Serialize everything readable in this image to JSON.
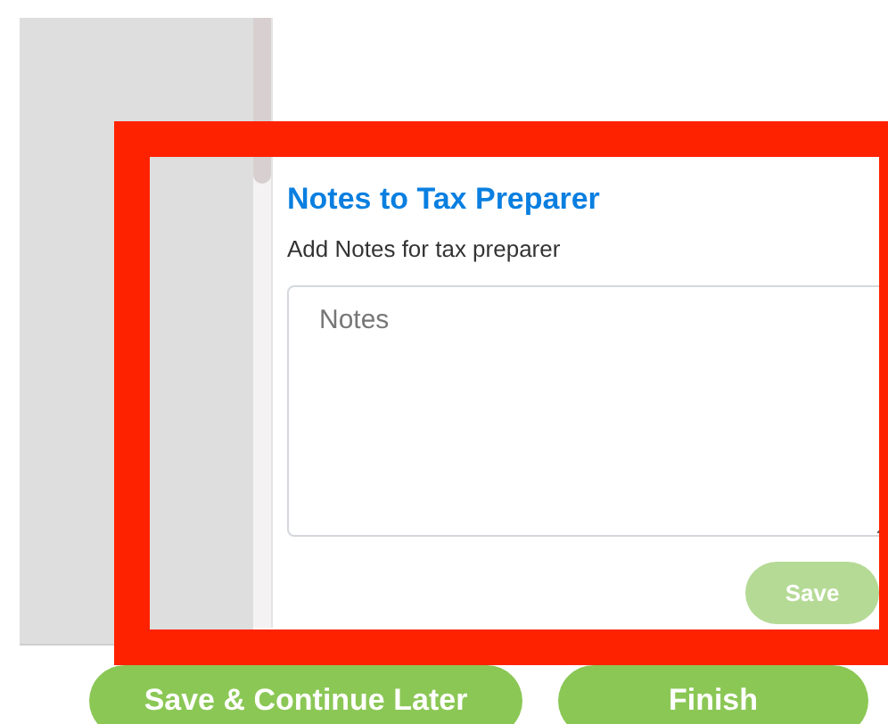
{
  "notes_panel": {
    "title": "Notes to Tax Preparer",
    "subtitle": "Add Notes for tax preparer",
    "notes_field": {
      "placeholder": "Notes"
    },
    "save_button": {
      "label": "Save",
      "disabled": true
    }
  },
  "buttons": [
    {
      "label": "Save & Continue Later"
    },
    {
      "label": "Finish"
    }
  ]
}
